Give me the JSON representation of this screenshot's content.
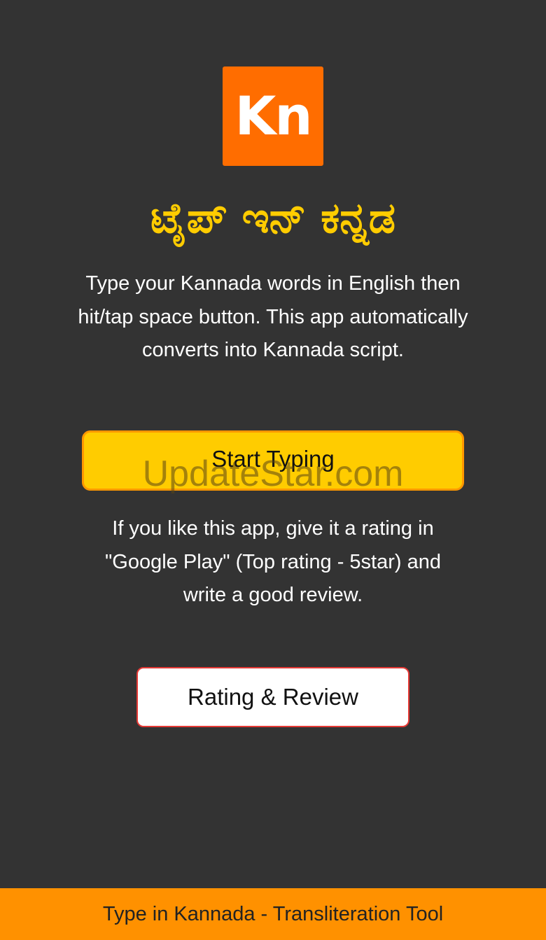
{
  "logo": {
    "text": "Kn"
  },
  "header": {
    "title": "ಟೈಪ್ ಇನ್ ಕನ್ನಡ"
  },
  "intro": {
    "text": "Type your Kannada words in English then hit/tap space button. This app automatically converts into Kannada script."
  },
  "actions": {
    "start_label": "Start Typing",
    "review_label": "Rating & Review"
  },
  "rating": {
    "text": "If you like this app, give it a rating in \"Google Play\" (Top rating - 5star) and write a good review."
  },
  "watermark": {
    "text": "UpdateStar.com"
  },
  "footer": {
    "text": "Type in Kannada - Transliteration Tool"
  },
  "colors": {
    "background": "#333333",
    "accent_yellow": "#ffcc00",
    "accent_orange": "#ff9100",
    "logo_orange": "#ff6d00",
    "review_border": "#e53935"
  }
}
